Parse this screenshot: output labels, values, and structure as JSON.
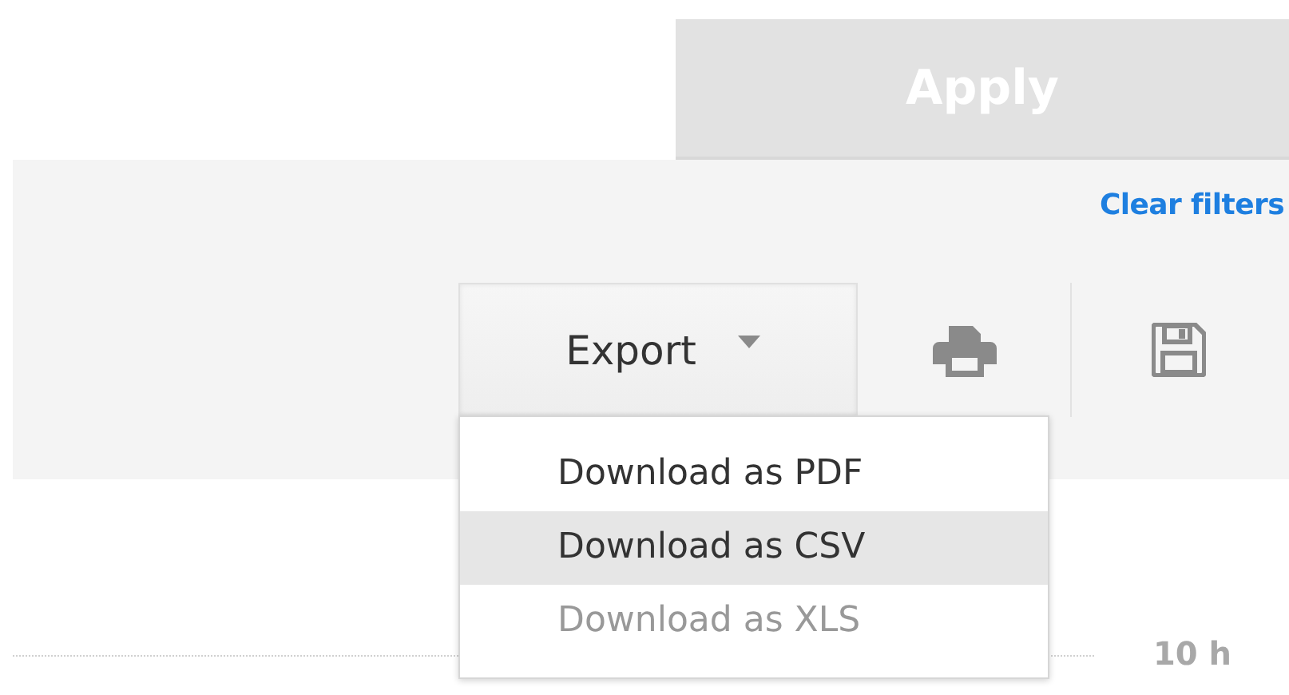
{
  "apply_button": {
    "label": "Apply",
    "disabled": true
  },
  "toolbar": {
    "clear_filters": "Clear filters",
    "export_button": {
      "label": "Export",
      "expanded": true
    },
    "export_menu": [
      {
        "label": "Download as PDF",
        "selected": false,
        "disabled": false
      },
      {
        "label": "Download as CSV",
        "selected": true,
        "disabled": false
      },
      {
        "label": "Download as XLS",
        "selected": false,
        "disabled": true
      }
    ]
  },
  "axis_label": "10 h"
}
